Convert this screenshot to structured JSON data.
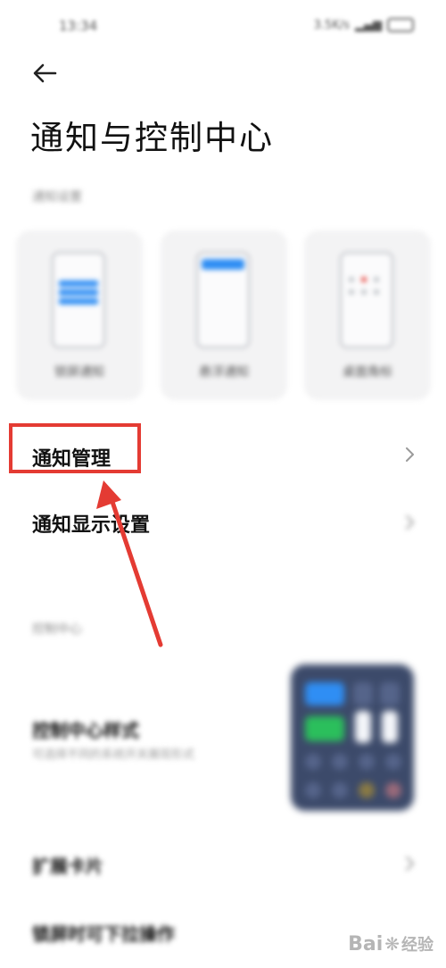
{
  "status_bar": {
    "time": "13:34",
    "right_text": "3.5K/s"
  },
  "header": {
    "title": "通知与控制中心"
  },
  "notification_settings": {
    "caption": "通知设置",
    "styles": [
      {
        "label": "锁屏通知"
      },
      {
        "label": "悬浮通知"
      },
      {
        "label": "桌面角标"
      }
    ]
  },
  "menu": {
    "notification_management": "通知管理",
    "notification_display": "通知显示设置"
  },
  "control_center": {
    "caption": "控制中心",
    "style_title": "控制中心样式",
    "style_subtitle": "可选择不同的系统开关展现形式",
    "expand_cards": "扩展卡片",
    "lockscreen_pulldown": "锁屏时可下拉操作"
  },
  "watermark": {
    "text": "Bai",
    "suffix": "经验"
  },
  "colors": {
    "accent_blue": "#2f8ef4",
    "highlight_red": "#e43b33",
    "tile_green": "#2bbf5c"
  }
}
